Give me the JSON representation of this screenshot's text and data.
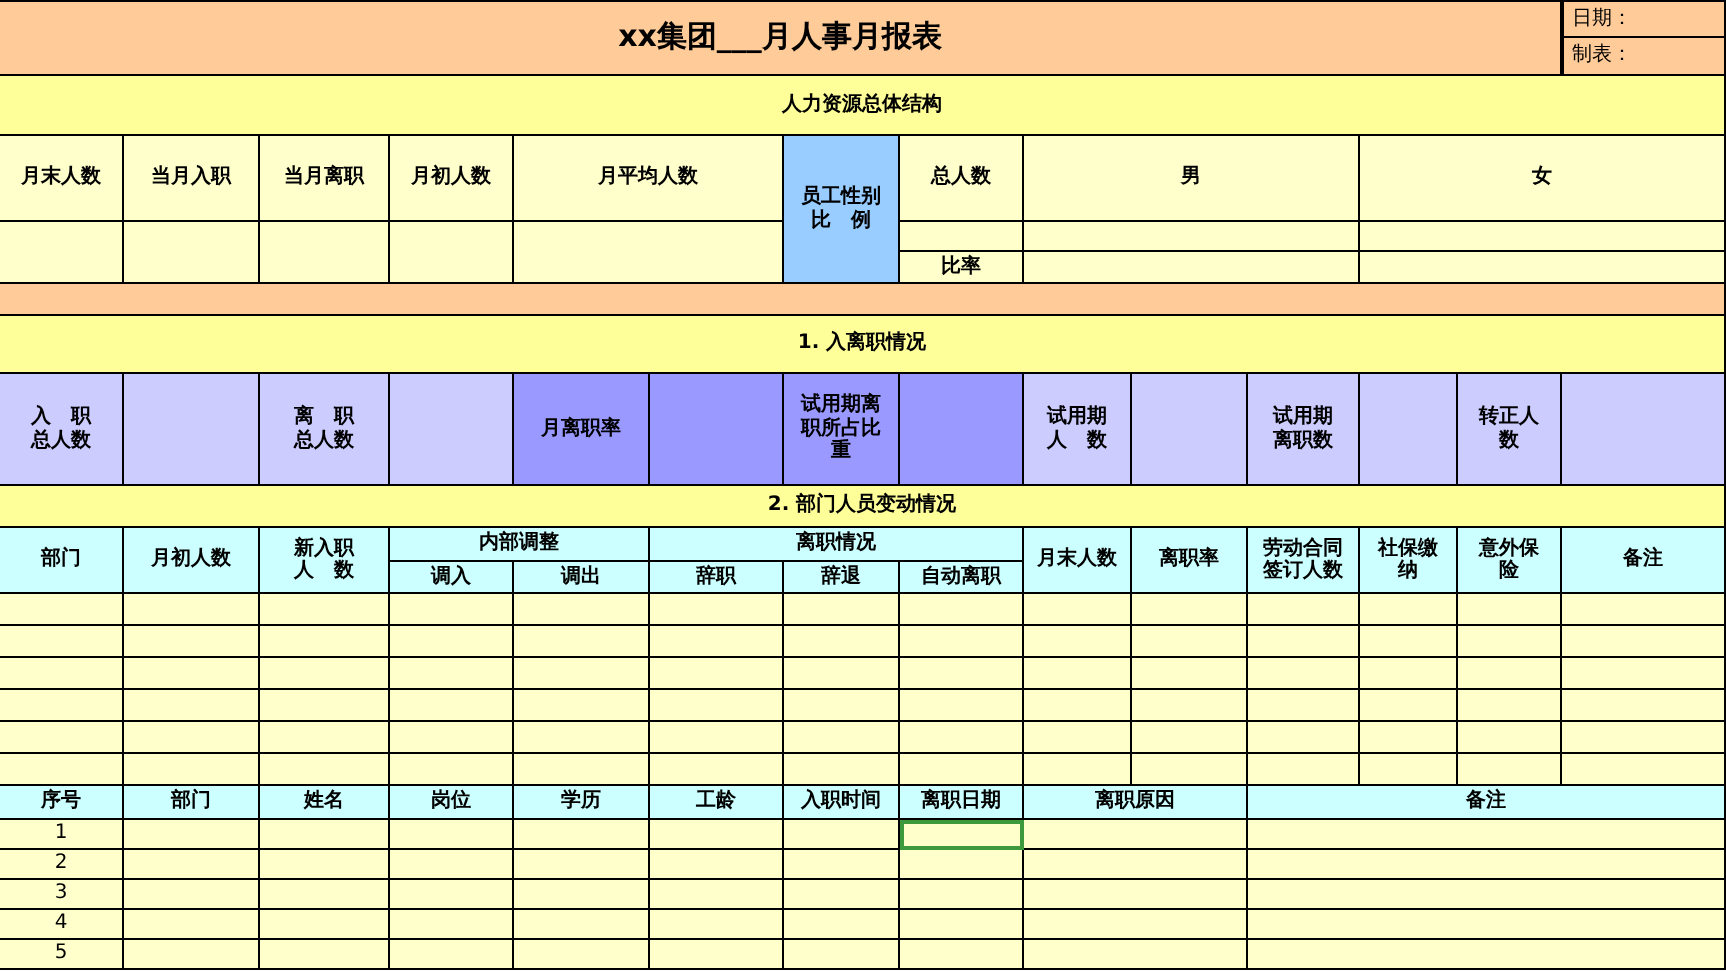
{
  "title": "xx集团___月人事月报表",
  "date_label": "日期：",
  "maker_label": "制表：",
  "structure": {
    "heading": "人力资源总体结构",
    "columns": [
      "月末人数",
      "当月入职",
      "当月离职",
      "月初人数",
      "月平均人数"
    ],
    "gender_label": "员工性别比　例",
    "total_label": "总人数",
    "ratio_label": "比率",
    "male": "男",
    "female": "女"
  },
  "turnover": {
    "heading": "1. 入离职情况",
    "labels": [
      "入　职总人数",
      "离　职总人数",
      "月离职率",
      "试用期离职所占比重",
      "试用期人　数",
      "试用期离职数",
      "转正人数"
    ]
  },
  "dept_changes": {
    "heading": "2. 部门人员变动情况",
    "lead_columns": [
      "部门",
      "月初人数",
      "新入职人　数"
    ],
    "internal_group": "内部调整",
    "internal": [
      "调入",
      "调出"
    ],
    "leave_group": "离职情况",
    "leave": [
      "辞职",
      "辞退",
      "自动离职"
    ],
    "tail_columns": [
      "月末人数",
      "离职率",
      "劳动合同签订人数",
      "社保缴纳",
      "意外保险",
      "备注"
    ]
  },
  "leavers": {
    "columns": [
      "序号",
      "部门",
      "姓名",
      "岗位",
      "学历",
      "工龄",
      "入职时间",
      "离职日期",
      "离职原因",
      "备注"
    ],
    "rows": [
      {
        "number": "1",
        "cells": [
          {
            "selected": false
          },
          {
            "selected": false
          },
          {
            "selected": false
          },
          {
            "selected": false
          },
          {
            "selected": false
          },
          {
            "selected": false
          },
          {
            "selected": true
          },
          {
            "selected": false
          },
          {
            "selected": false
          }
        ]
      },
      {
        "number": "2",
        "cells": [
          {
            "selected": false
          },
          {
            "selected": false
          },
          {
            "selected": false
          },
          {
            "selected": false
          },
          {
            "selected": false
          },
          {
            "selected": false
          },
          {
            "selected": false
          },
          {
            "selected": false
          },
          {
            "selected": false
          }
        ]
      },
      {
        "number": "3",
        "cells": [
          {
            "selected": false
          },
          {
            "selected": false
          },
          {
            "selected": false
          },
          {
            "selected": false
          },
          {
            "selected": false
          },
          {
            "selected": false
          },
          {
            "selected": false
          },
          {
            "selected": false
          },
          {
            "selected": false
          }
        ]
      },
      {
        "number": "4",
        "cells": [
          {
            "selected": false
          },
          {
            "selected": false
          },
          {
            "selected": false
          },
          {
            "selected": false
          },
          {
            "selected": false
          },
          {
            "selected": false
          },
          {
            "selected": false
          },
          {
            "selected": false
          },
          {
            "selected": false
          }
        ]
      },
      {
        "number": "5",
        "cells": [
          {
            "selected": false
          },
          {
            "selected": false
          },
          {
            "selected": false
          },
          {
            "selected": false
          },
          {
            "selected": false
          },
          {
            "selected": false
          },
          {
            "selected": false
          },
          {
            "selected": false
          },
          {
            "selected": false
          }
        ]
      }
    ]
  }
}
